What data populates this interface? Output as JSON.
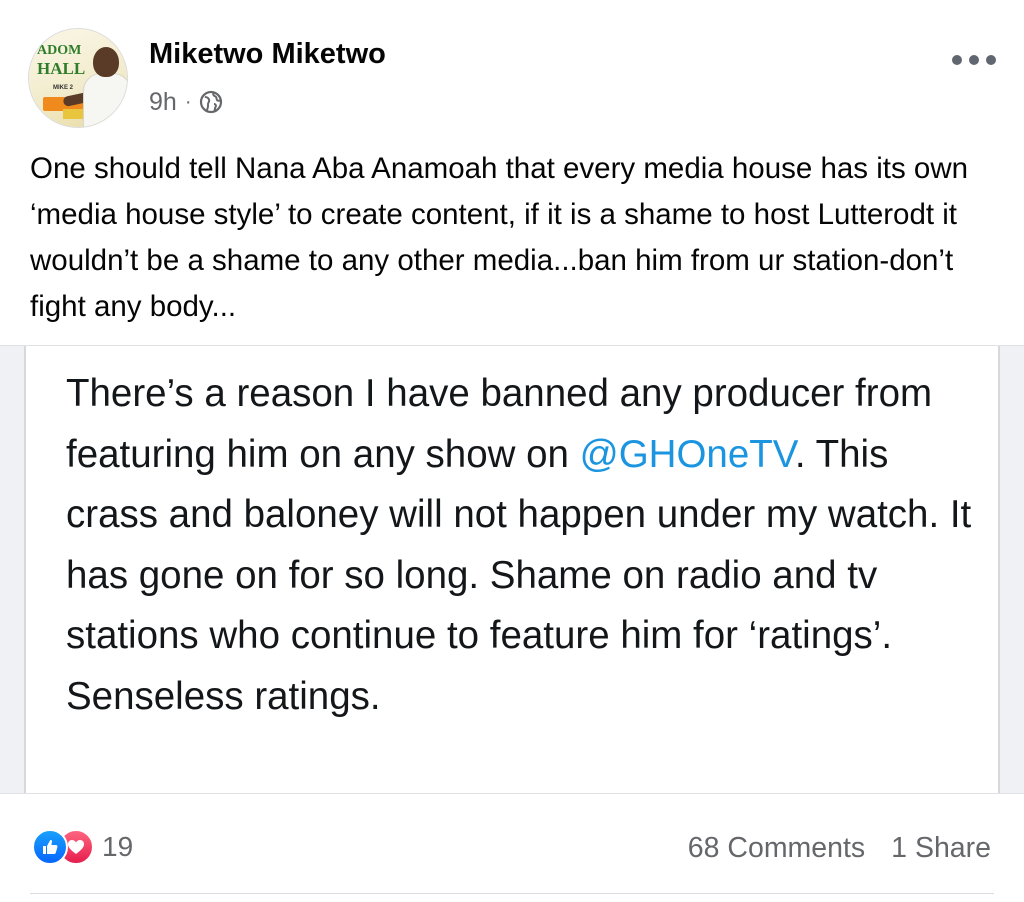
{
  "post": {
    "author": {
      "name": "Miketwo Miketwo",
      "avatar_brand_top": "ADOM",
      "avatar_brand_bottom": "HALL",
      "avatar_tagline": "MIKE 2"
    },
    "timestamp": "9h",
    "separator": "·",
    "audience_icon": "globe-icon",
    "more_icon": "more-options-icon",
    "caption": "One should tell Nana Aba Anamoah that every media house has its own ‘media house style’ to create content, if it is a shame to host Lutterodt it wouldn’t be a shame to any other media...ban him from ur station-don’t fight any body...",
    "attachment": {
      "text_before_mention": "There’s a reason I have banned any producer from featuring him on any show on ",
      "mention": "@GHOneTV",
      "text_after_mention": ". This crass and baloney will not happen under my watch. It has gone on for so long. Shame on radio and tv stations who continue to feature him for ‘ratings’. Senseless ratings."
    },
    "reactions": {
      "icons": [
        "like-icon",
        "love-icon"
      ],
      "count": "19"
    },
    "comments_label": "68 Comments",
    "shares_label": "1 Share"
  },
  "colors": {
    "like": "#0866ff",
    "love": "#e61e4d",
    "mention": "#1b95e0",
    "meta_text": "#65676b"
  }
}
